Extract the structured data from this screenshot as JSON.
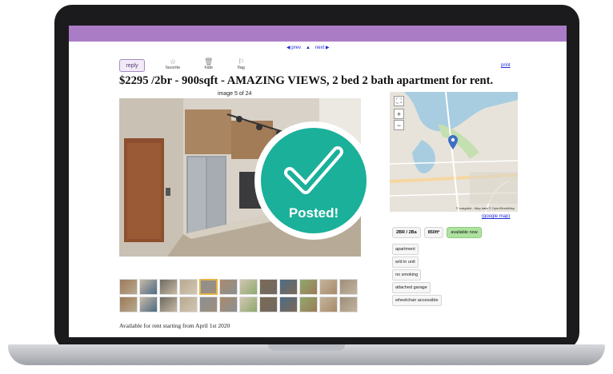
{
  "nav": {
    "prev": "◀ prev",
    "up": "▲",
    "next": "next ▶"
  },
  "actions": {
    "reply": "reply",
    "favorite": "favorite",
    "hide": "hide",
    "flag": "flag",
    "print": "print"
  },
  "listing": {
    "title": "$2295 /2br - 900sqft - AMAZING VIEWS, 2 bed 2 bath apartment for rent.",
    "image_count": "image 5 of 24",
    "description": "Available for rent starting from April 1st 2020"
  },
  "map": {
    "attribution": "© craigslist - Map data © OpenStreetMap",
    "google_map": "(google map)"
  },
  "attributes": {
    "bed_bath": "2BR / 2Ba",
    "sqft": "850ft²",
    "availability": "available now"
  },
  "tags": [
    "apartment",
    "w/d in unit",
    "no smoking",
    "attached garage",
    "wheelchair accessible"
  ],
  "overlay": {
    "label": "Posted!"
  },
  "colors": {
    "header": "#ab7cc6",
    "posted": "#1bb09a",
    "link": "#1f2bd9",
    "available": "#aee2a0"
  }
}
